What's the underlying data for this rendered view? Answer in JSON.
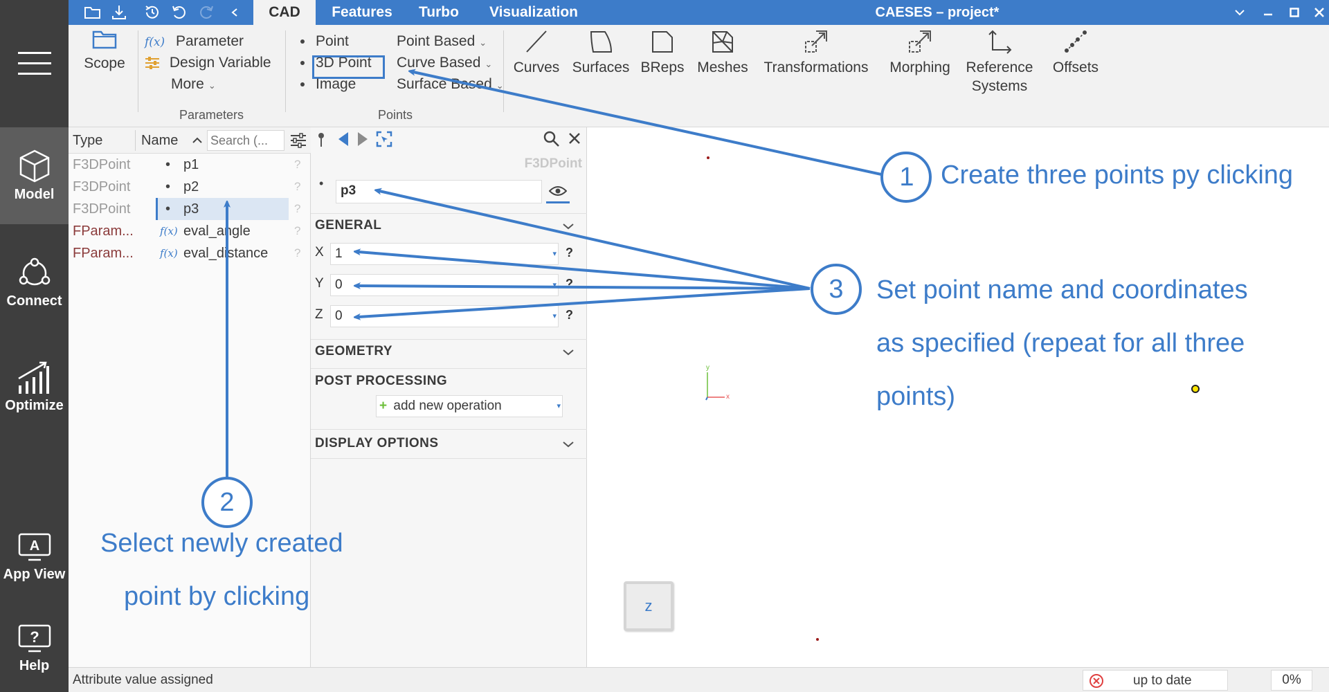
{
  "app": {
    "title": "CAESES  –  project*"
  },
  "tabs": [
    "CAD",
    "Features",
    "Turbo",
    "Visualization"
  ],
  "leftnav": {
    "items": [
      {
        "label": "Model",
        "icon": "cube-icon"
      },
      {
        "label": "Connect",
        "icon": "connect-icon"
      },
      {
        "label": "Optimize",
        "icon": "optimize-chart-icon"
      },
      {
        "label": "App View",
        "icon": "app-view-icon"
      },
      {
        "label": "Help",
        "icon": "help-icon"
      }
    ]
  },
  "ribbon": {
    "scope": "Scope",
    "parameters": {
      "fx": "f(x)",
      "parameter": "Parameter",
      "design_variable": "Design Variable",
      "more": "More",
      "group": "Parameters"
    },
    "points": {
      "point": "Point",
      "point_3d": "3D Point",
      "image": "Image",
      "point_based": "Point Based",
      "curve_based": "Curve Based",
      "surface_based": "Surface Based",
      "group": "Points"
    },
    "big": [
      "Curves",
      "Surfaces",
      "BReps",
      "Meshes",
      "Transformations",
      "Morphing",
      "Reference",
      "Systems",
      "Offsets"
    ]
  },
  "tree": {
    "headers": {
      "type": "Type",
      "name": "Name",
      "search_placeholder": "Search (..."
    },
    "rows": [
      {
        "type": "F3DPoint",
        "name": "p1",
        "prefix": "•",
        "q": "?"
      },
      {
        "type": "F3DPoint",
        "name": "p2",
        "prefix": "•",
        "q": "?"
      },
      {
        "type": "F3DPoint",
        "name": "p3",
        "prefix": "•",
        "q": "?"
      },
      {
        "type": "FParam...",
        "name": "eval_angle",
        "prefix": "f(x)",
        "q": "?"
      },
      {
        "type": "FParam...",
        "name": "eval_distance",
        "prefix": "f(x)",
        "q": "?"
      }
    ]
  },
  "props": {
    "type_label": "F3DPoint",
    "name_value": "p3",
    "general": "GENERAL",
    "x_label": "X",
    "x_value": "1",
    "y_label": "Y",
    "y_value": "0",
    "z_label": "Z",
    "z_value": "0",
    "help": "?",
    "geometry": "GEOMETRY",
    "post_processing": "POST PROCESSING",
    "add_operation": "add new operation",
    "display_options": "DISPLAY OPTIONS"
  },
  "viewport": {
    "cube_label": "z",
    "axis_x": "x",
    "axis_y": "y",
    "point_color": "#ffe600"
  },
  "status": {
    "message": "Attribute value assigned",
    "state": "up to date",
    "progress": "0%"
  },
  "annotations": {
    "step1": {
      "num": "1",
      "text": "Create  three points py clicking"
    },
    "step2": {
      "num": "2",
      "line1": "Select newly created",
      "line2": "point by clicking"
    },
    "step3": {
      "num": "3",
      "line1": "Set point name and coordinates",
      "line2": "as specified (repeat for all three",
      "line3": "points)"
    }
  },
  "colors": {
    "accent": "#3d7cc9",
    "sidebar": "#3e3e3e",
    "ribbon": "#f2f2f2"
  }
}
